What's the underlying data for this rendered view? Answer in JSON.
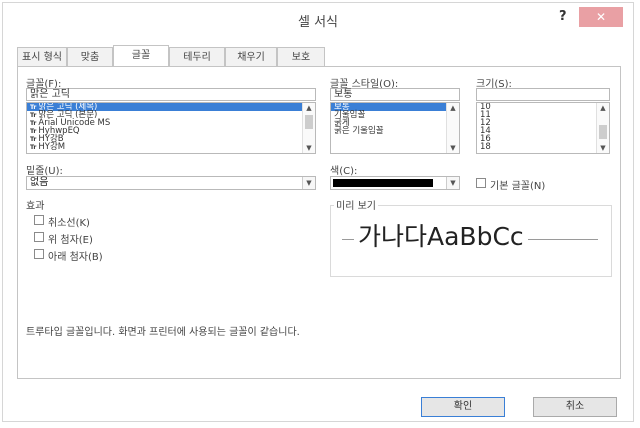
{
  "window": {
    "title": "셀 서식",
    "help_label": "?",
    "close_label": "✕"
  },
  "tabs": [
    {
      "label": "표시 형식"
    },
    {
      "label": "맞춤"
    },
    {
      "label": "글꼴"
    },
    {
      "label": "테두리"
    },
    {
      "label": "채우기"
    },
    {
      "label": "보호"
    }
  ],
  "active_tab": "글꼴",
  "font": {
    "label": "글꼴(F):",
    "value": "맑은 고딕",
    "list": [
      {
        "text": "맑은 고딕 (제목)",
        "tt": "Tr",
        "selected": true
      },
      {
        "text": "맑은 고딕 (본문)",
        "tt": "Tr"
      },
      {
        "text": "Arial Unicode MS",
        "tt": "Tr"
      },
      {
        "text": "HyhwpEQ",
        "tt": "Tr"
      },
      {
        "text": "HY강B",
        "tt": "Tr"
      },
      {
        "text": "HY강M",
        "tt": "Tr"
      }
    ]
  },
  "style": {
    "label": "글꼴 스타일(O):",
    "value": "보통",
    "list": [
      {
        "text": "보통",
        "selected": true
      },
      {
        "text": "기울임꼴"
      },
      {
        "text": "굵게"
      },
      {
        "text": "굵은 기울임꼴"
      }
    ]
  },
  "size": {
    "label": "크기(S):",
    "value": "",
    "list": [
      "10",
      "11",
      "12",
      "14",
      "16",
      "18"
    ]
  },
  "underline": {
    "label": "밑줄(U):",
    "value": "없음"
  },
  "color": {
    "label": "색(C):",
    "swatch": "#000000"
  },
  "normal_font": {
    "label": "기본 글꼴(N)"
  },
  "effects": {
    "label": "효과",
    "items": [
      {
        "label": "취소선(K)"
      },
      {
        "label": "위 첨자(E)"
      },
      {
        "label": "아래 첨자(B)"
      }
    ]
  },
  "preview": {
    "label": "미리 보기",
    "sample": "가나다AaBbCc"
  },
  "note": "트루타입 글꼴입니다. 화면과 프린터에 사용되는 글꼴이 같습니다.",
  "buttons": {
    "ok": "확인",
    "cancel": "취소"
  }
}
